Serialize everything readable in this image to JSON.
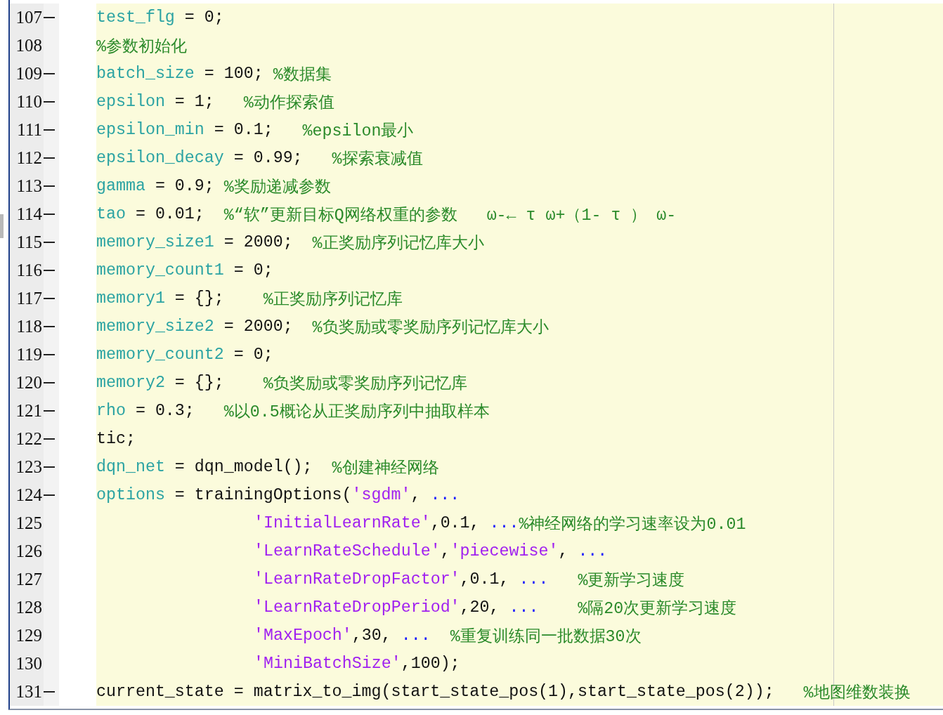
{
  "editor": {
    "lines": [
      {
        "number": "107",
        "executable": true,
        "kind": "statement",
        "tokens": [
          {
            "kind": "var",
            "text": "test_flg"
          },
          {
            "kind": "plain",
            "text": " = 0;"
          }
        ]
      },
      {
        "number": "108",
        "executable": false,
        "kind": "statement",
        "tokens": [
          {
            "kind": "comment",
            "text": "%参数初始化"
          }
        ]
      },
      {
        "number": "109",
        "executable": true,
        "kind": "statement",
        "tokens": [
          {
            "kind": "var",
            "text": "batch_size"
          },
          {
            "kind": "plain",
            "text": " = 100; "
          },
          {
            "kind": "comment",
            "text": "%数据集"
          }
        ]
      },
      {
        "number": "110",
        "executable": true,
        "kind": "statement",
        "tokens": [
          {
            "kind": "var",
            "text": "epsilon"
          },
          {
            "kind": "plain",
            "text": " = 1;   "
          },
          {
            "kind": "comment",
            "text": "%动作探索值"
          }
        ]
      },
      {
        "number": "111",
        "executable": true,
        "kind": "statement",
        "tokens": [
          {
            "kind": "var",
            "text": "epsilon_min"
          },
          {
            "kind": "plain",
            "text": " = 0.1;   "
          },
          {
            "kind": "comment",
            "text": "%epsilon最小"
          }
        ]
      },
      {
        "number": "112",
        "executable": true,
        "kind": "statement",
        "tokens": [
          {
            "kind": "var",
            "text": "epsilon_decay"
          },
          {
            "kind": "plain",
            "text": " = 0.99;   "
          },
          {
            "kind": "comment",
            "text": "%探索衰减值"
          }
        ]
      },
      {
        "number": "113",
        "executable": true,
        "kind": "statement",
        "tokens": [
          {
            "kind": "var",
            "text": "gamma"
          },
          {
            "kind": "plain",
            "text": " = 0.9; "
          },
          {
            "kind": "comment",
            "text": "%奖励递减参数"
          }
        ]
      },
      {
        "number": "114",
        "executable": true,
        "kind": "statement",
        "tokens": [
          {
            "kind": "var",
            "text": "tao"
          },
          {
            "kind": "plain",
            "text": " = 0.01;  "
          },
          {
            "kind": "comment",
            "text": "%“软”更新目标Q网络权重的参数   ω-← τ ω+（1- τ ） ω-"
          }
        ]
      },
      {
        "number": "115",
        "executable": true,
        "kind": "statement",
        "tokens": [
          {
            "kind": "var",
            "text": "memory_size1"
          },
          {
            "kind": "plain",
            "text": " = 2000;  "
          },
          {
            "kind": "comment",
            "text": "%正奖励序列记忆库大小"
          }
        ]
      },
      {
        "number": "116",
        "executable": true,
        "kind": "statement",
        "tokens": [
          {
            "kind": "var",
            "text": "memory_count1"
          },
          {
            "kind": "plain",
            "text": " = 0;"
          }
        ]
      },
      {
        "number": "117",
        "executable": true,
        "kind": "statement",
        "tokens": [
          {
            "kind": "var",
            "text": "memory1"
          },
          {
            "kind": "plain",
            "text": " = {};    "
          },
          {
            "kind": "comment",
            "text": "%正奖励序列记忆库"
          }
        ]
      },
      {
        "number": "118",
        "executable": true,
        "kind": "statement",
        "tokens": [
          {
            "kind": "var",
            "text": "memory_size2"
          },
          {
            "kind": "plain",
            "text": " = 2000;  "
          },
          {
            "kind": "comment",
            "text": "%负奖励或零奖励序列记忆库大小"
          }
        ]
      },
      {
        "number": "119",
        "executable": true,
        "kind": "statement",
        "tokens": [
          {
            "kind": "var",
            "text": "memory_count2"
          },
          {
            "kind": "plain",
            "text": " = 0;"
          }
        ]
      },
      {
        "number": "120",
        "executable": true,
        "kind": "statement",
        "tokens": [
          {
            "kind": "var",
            "text": "memory2"
          },
          {
            "kind": "plain",
            "text": " = {};    "
          },
          {
            "kind": "comment",
            "text": "%负奖励或零奖励序列记忆库"
          }
        ]
      },
      {
        "number": "121",
        "executable": true,
        "kind": "statement",
        "tokens": [
          {
            "kind": "var",
            "text": "rho"
          },
          {
            "kind": "plain",
            "text": " = 0.3;   "
          },
          {
            "kind": "comment",
            "text": "%以0.5概论从正奖励序列中抽取样本"
          }
        ]
      },
      {
        "number": "122",
        "executable": true,
        "kind": "statement",
        "tokens": [
          {
            "kind": "plain",
            "text": "tic;"
          }
        ]
      },
      {
        "number": "123",
        "executable": true,
        "kind": "statement",
        "tokens": [
          {
            "kind": "var",
            "text": "dqn_net"
          },
          {
            "kind": "plain",
            "text": " = dqn_model();  "
          },
          {
            "kind": "comment",
            "text": "%创建神经网络"
          }
        ]
      },
      {
        "number": "124",
        "executable": true,
        "kind": "statement",
        "tokens": [
          {
            "kind": "var",
            "text": "options"
          },
          {
            "kind": "plain",
            "text": " = trainingOptions("
          },
          {
            "kind": "string",
            "text": "'sgdm'"
          },
          {
            "kind": "plain",
            "text": ", "
          },
          {
            "kind": "continuation",
            "text": "..."
          }
        ]
      },
      {
        "number": "125",
        "executable": false,
        "kind": "continuation",
        "tokens": [
          {
            "kind": "string",
            "text": "'InitialLearnRate'"
          },
          {
            "kind": "plain",
            "text": ",0.1, "
          },
          {
            "kind": "continuation",
            "text": "..."
          },
          {
            "kind": "comment",
            "text": "%神经网络的学习速率设为0.01"
          }
        ]
      },
      {
        "number": "126",
        "executable": false,
        "kind": "continuation",
        "tokens": [
          {
            "kind": "string",
            "text": "'LearnRateSchedule'"
          },
          {
            "kind": "plain",
            "text": ","
          },
          {
            "kind": "string",
            "text": "'piecewise'"
          },
          {
            "kind": "plain",
            "text": ", "
          },
          {
            "kind": "continuation",
            "text": "..."
          }
        ]
      },
      {
        "number": "127",
        "executable": false,
        "kind": "continuation",
        "tokens": [
          {
            "kind": "string",
            "text": "'LearnRateDropFactor'"
          },
          {
            "kind": "plain",
            "text": ",0.1, "
          },
          {
            "kind": "continuation",
            "text": "..."
          },
          {
            "kind": "comment",
            "text": "   %更新学习速度"
          }
        ]
      },
      {
        "number": "128",
        "executable": false,
        "kind": "continuation",
        "tokens": [
          {
            "kind": "string",
            "text": "'LearnRateDropPeriod'"
          },
          {
            "kind": "plain",
            "text": ",20, "
          },
          {
            "kind": "continuation",
            "text": "..."
          },
          {
            "kind": "comment",
            "text": "    %隔20次更新学习速度"
          }
        ]
      },
      {
        "number": "129",
        "executable": false,
        "kind": "continuation",
        "tokens": [
          {
            "kind": "string",
            "text": "'MaxEpoch'"
          },
          {
            "kind": "plain",
            "text": ",30, "
          },
          {
            "kind": "continuation",
            "text": "..."
          },
          {
            "kind": "comment",
            "text": "  %重复训练同一批数据30次"
          }
        ]
      },
      {
        "number": "130",
        "executable": false,
        "kind": "continuation",
        "tokens": [
          {
            "kind": "string",
            "text": "'MiniBatchSize'"
          },
          {
            "kind": "plain",
            "text": ",100);"
          }
        ]
      },
      {
        "number": "131",
        "executable": true,
        "kind": "statement",
        "tokens": [
          {
            "kind": "plain",
            "text": "current_state = matrix_to_img(start_state_pos(1),start_state_pos(2));   "
          },
          {
            "kind": "comment",
            "text": "%地图维数装换"
          }
        ]
      }
    ]
  }
}
